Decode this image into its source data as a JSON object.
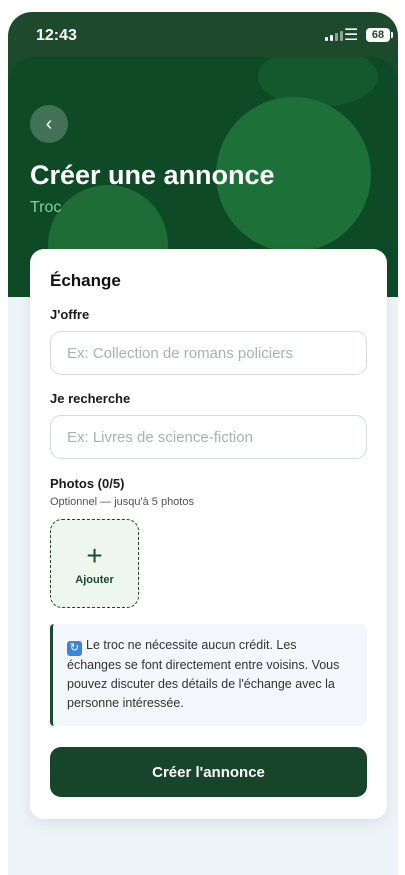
{
  "status_bar": {
    "time": "12:43",
    "battery": "68"
  },
  "header": {
    "back_glyph": "‹",
    "title": "Créer une annonce",
    "subtitle": "Troc"
  },
  "form": {
    "section_title": "Échange",
    "offer": {
      "label": "J'offre",
      "placeholder": "Ex: Collection de romans policiers"
    },
    "search": {
      "label": "Je recherche",
      "placeholder": "Ex: Livres de science-fiction"
    },
    "photos": {
      "label": "Photos (0/5)",
      "hint": "Optionnel — jusqu'à 5 photos",
      "add_label": "Ajouter"
    },
    "info_text": "Le troc ne nécessite aucun crédit. Les échanges se font directement entre voisins. Vous pouvez discuter des détails de l'échange avec la personne intéressée.",
    "submit_label": "Créer l'annonce"
  },
  "colors": {
    "primary": "#17452a",
    "hero": "#0f4a26",
    "accent_text": "#7ed49b"
  }
}
